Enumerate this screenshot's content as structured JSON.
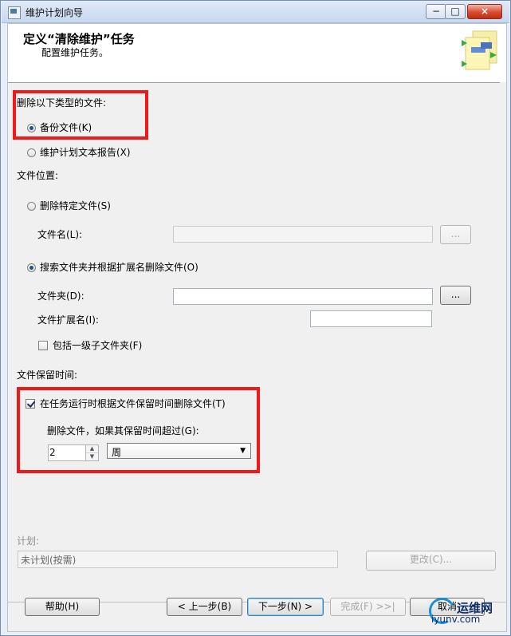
{
  "window": {
    "title": "维护计划向导",
    "controls": {
      "minimize": "−",
      "maximize": "□",
      "close": "×"
    }
  },
  "header": {
    "title": "定义“清除维护”任务",
    "subtitle": "配置维护任务。",
    "icon": "wizard-icon"
  },
  "delete_type": {
    "label": "删除以下类型的文件:",
    "options": [
      {
        "label": "备份文件(K)",
        "selected": true
      },
      {
        "label": "维护计划文本报告(X)",
        "selected": false
      }
    ]
  },
  "file_location": {
    "label": "文件位置:",
    "specific_file": {
      "label": "删除特定文件(S)",
      "selected": false,
      "file_name_label": "文件名(L):",
      "file_name_value": "",
      "browse_label": "..."
    },
    "search_folder": {
      "label": "搜索文件夹并根据扩展名删除文件(O)",
      "selected": true,
      "folder_label": "文件夹(D):",
      "folder_value": "",
      "browse_label": "...",
      "extension_label": "文件扩展名(I):",
      "extension_value": "",
      "subfolders_label": "包括一级子文件夹(F)",
      "subfolders_checked": false
    }
  },
  "retention": {
    "label": "文件保留时间:",
    "delete_by_age": {
      "label": "在任务运行时根据文件保留时间删除文件(T)",
      "checked": true
    },
    "older_than_label": "删除文件，如果其保留时间超过(G):",
    "age_value": "2",
    "unit": "周"
  },
  "schedule": {
    "label": "计划:",
    "value": "未计划(按需)",
    "change_label": "更改(C)..."
  },
  "footer": {
    "help_label": "帮助(H)",
    "back_label": "< 上一步(B)",
    "next_label": "下一步(N) >",
    "finish_label": "完成(F) >>|",
    "cancel_label": "取消"
  },
  "watermark": {
    "brand": "运维网",
    "url": "iyunv.com"
  },
  "colors": {
    "highlight": "#f01818",
    "accent": "#1f4f94"
  }
}
